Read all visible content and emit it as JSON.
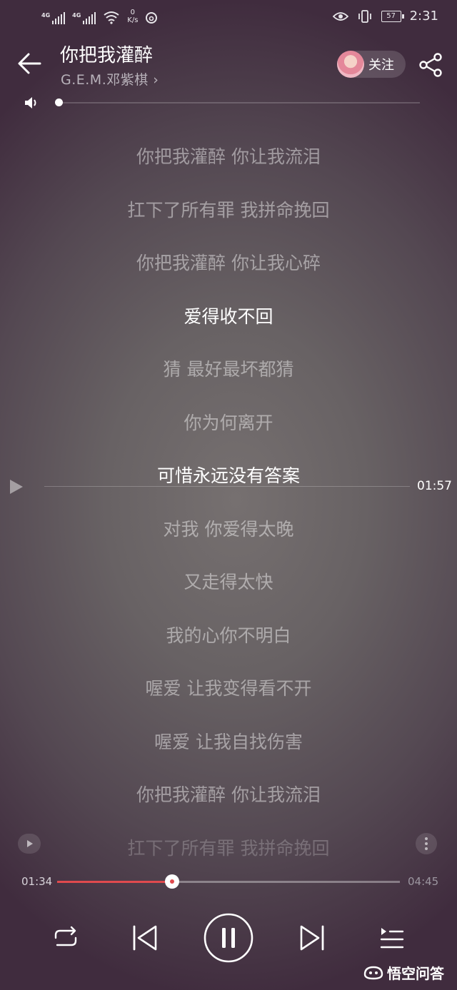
{
  "status_bar": {
    "sim1_tag": "4G",
    "sim2_tag": "4G",
    "net_speed_value": "0",
    "net_speed_unit": "K/s",
    "battery_level": "57",
    "time": "2:31"
  },
  "header": {
    "title": "你把我灌醉",
    "artist": "G.E.M.邓紫棋",
    "artist_chevron": "›",
    "follow_label": "关注"
  },
  "volume": {
    "level": 0.0
  },
  "lyrics": [
    {
      "text": "你把我灌醉 你让我流泪",
      "state": "normal"
    },
    {
      "text": "扛下了所有罪 我拼命挽回",
      "state": "normal"
    },
    {
      "text": "你把我灌醉 你让我心碎",
      "state": "normal"
    },
    {
      "text": "爱得收不回",
      "state": "active"
    },
    {
      "text": "猜 最好最坏都猜",
      "state": "normal"
    },
    {
      "text": "你为何离开",
      "state": "normal"
    },
    {
      "text": "可惜永远没有答案",
      "state": "active"
    },
    {
      "text": "对我 你爱得太晚",
      "state": "normal"
    },
    {
      "text": "又走得太快",
      "state": "normal"
    },
    {
      "text": "我的心你不明白",
      "state": "normal"
    },
    {
      "text": "喔爱 让我变得看不开",
      "state": "normal"
    },
    {
      "text": "喔爱 让我自找伤害",
      "state": "normal"
    },
    {
      "text": "你把我灌醉 你让我流泪",
      "state": "normal"
    },
    {
      "text": "扛下了所有罪 我拼命挽回",
      "state": "fade"
    }
  ],
  "seek_indicator": {
    "time": "01:57"
  },
  "playback": {
    "current_time": "01:34",
    "total_time": "04:45",
    "progress": 0.336
  },
  "watermark": {
    "text": "悟空问答"
  },
  "colors": {
    "progress_accent": "#e04a4e"
  }
}
